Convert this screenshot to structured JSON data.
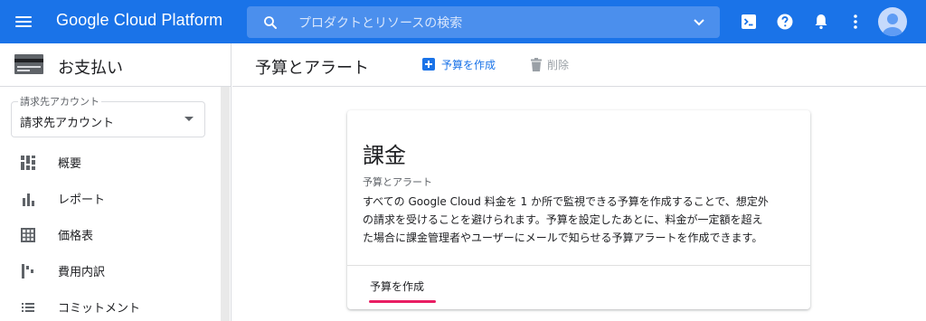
{
  "topbar": {
    "brand": "Google Cloud Platform",
    "search_placeholder": "プロダクトとリソースの検索",
    "icons": [
      "menu-icon",
      "search-icon",
      "chevron-down-icon",
      "cloud-shell-icon",
      "help-icon",
      "notifications-icon",
      "more-vert-icon",
      "account-icon"
    ]
  },
  "sidebar": {
    "title": "お支払い",
    "account": {
      "label": "請求先アカウント",
      "value": "請求先アカウント"
    },
    "items": [
      {
        "label": "概要",
        "icon": "dashboard-icon"
      },
      {
        "label": "レポート",
        "icon": "bar-chart-icon"
      },
      {
        "label": "価格表",
        "icon": "table-icon"
      },
      {
        "label": "費用内訳",
        "icon": "waterfall-icon"
      },
      {
        "label": "コミットメント",
        "icon": "list-icon"
      }
    ]
  },
  "page": {
    "title": "予算とアラート",
    "actions": {
      "create": "予算を作成",
      "delete": "削除"
    }
  },
  "card": {
    "title": "課金",
    "subtitle": "予算とアラート",
    "lines": [
      "すべての Google Cloud 料金を 1 か所で監視できる予算を作成することで、想定外",
      "の請求を受けることを避けられます。予算を設定したあとに、料金が一定額を超え",
      "た場合に課金管理者やユーザーにメールで知らせる予算アラートを作成できます。"
    ],
    "button": "予算を作成"
  },
  "colors": {
    "primary": "#1a73e8",
    "search_bg": "#4b8fed",
    "highlight": "#e91e63",
    "disabled": "#9aa0a6"
  }
}
